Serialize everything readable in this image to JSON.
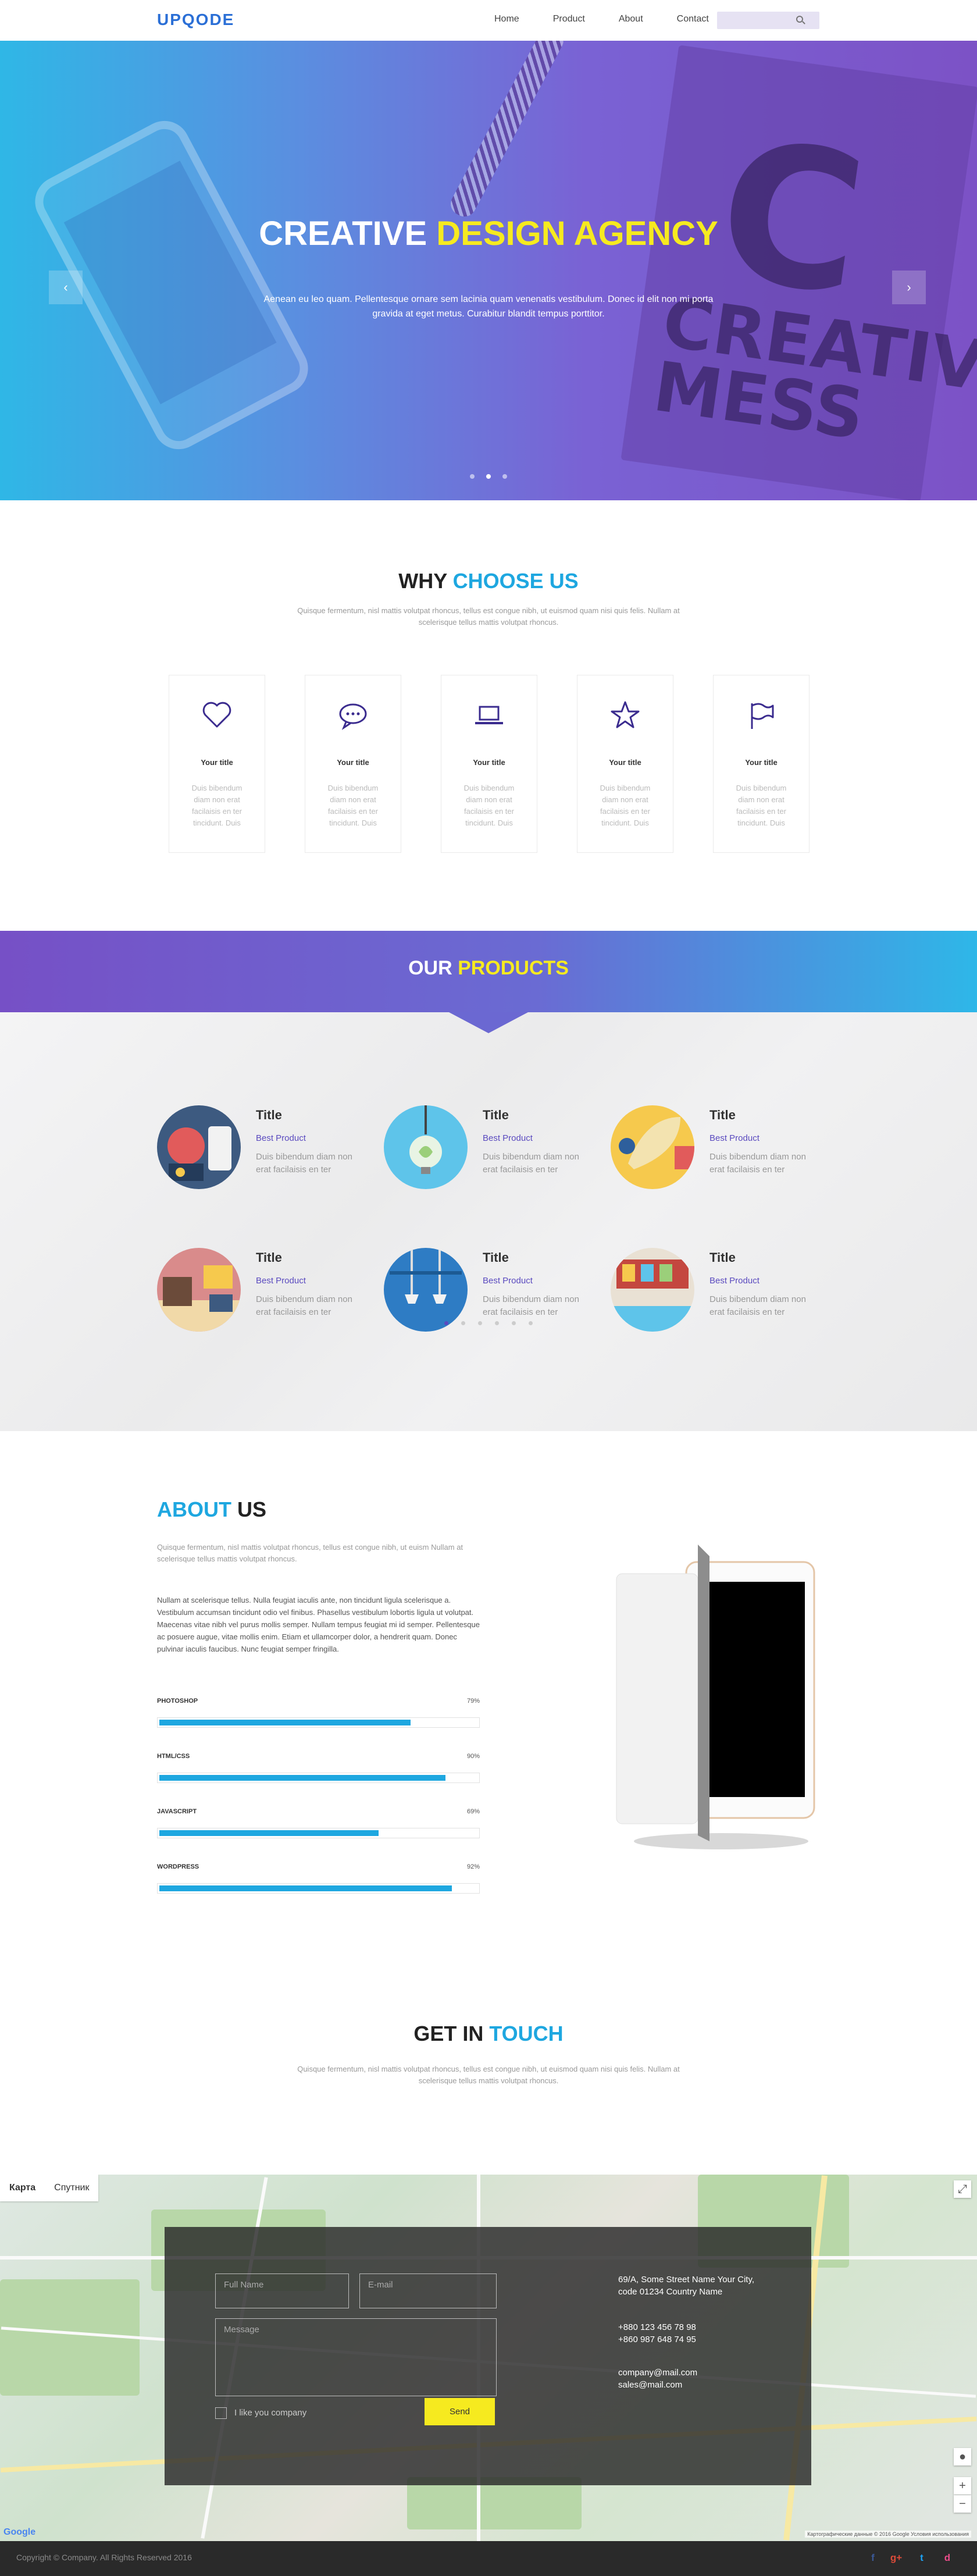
{
  "header": {
    "logo": "UPQODE",
    "nav": [
      "Home",
      "Product",
      "About",
      "Contact"
    ]
  },
  "hero": {
    "title_part1": "CREATIVE",
    "title_part2": "DESIGN AGENCY",
    "text": "Aenean eu leo quam. Pellentesque ornare sem lacinia quam venenatis vestibulum. Donec id elit non mi porta gravida at eget metus. Curabitur blandit tempus porttitor.",
    "bg_letter": "C",
    "bg_words": [
      "CREATIVE",
      "MESS"
    ],
    "prev_arrow": "‹",
    "next_arrow": "›"
  },
  "why": {
    "title_part1": "WHY",
    "title_part2": "CHOOSE US",
    "subtitle": "Quisque fermentum, nisl mattis volutpat rhoncus, tellus est congue nibh, ut euismod quam nisi quis felis. Nullam at scelerisque tellus mattis volutpat rhoncus.",
    "cards": [
      {
        "icon": "heart-icon",
        "title": "Your title",
        "text": "Duis bibendum diam non erat facilaisis en ter tincidunt. Duis"
      },
      {
        "icon": "chat-icon",
        "title": "Your title",
        "text": "Duis bibendum diam non erat facilaisis en ter tincidunt. Duis"
      },
      {
        "icon": "laptop-icon",
        "title": "Your title",
        "text": "Duis bibendum diam non erat facilaisis en ter tincidunt. Duis"
      },
      {
        "icon": "star-icon",
        "title": "Your title",
        "text": "Duis bibendum diam non erat facilaisis en ter tincidunt. Duis"
      },
      {
        "icon": "flag-icon",
        "title": "Your title",
        "text": "Duis bibendum diam non erat facilaisis en ter tincidunt. Duis"
      }
    ]
  },
  "products": {
    "title_part1": "OUR",
    "title_part2": "PRODUCTS",
    "items": [
      {
        "title": "Title",
        "subtitle": "Best Product",
        "text": "Duis bibendum diam non erat facilaisis en ter"
      },
      {
        "title": "Title",
        "subtitle": "Best Product",
        "text": "Duis bibendum diam non erat facilaisis en ter"
      },
      {
        "title": "Title",
        "subtitle": "Best Product",
        "text": "Duis bibendum diam non erat facilaisis en ter"
      },
      {
        "title": "Title",
        "subtitle": "Best Product",
        "text": "Duis bibendum diam non erat facilaisis en ter"
      },
      {
        "title": "Title",
        "subtitle": "Best Product",
        "text": "Duis bibendum diam non erat facilaisis en ter"
      },
      {
        "title": "Title",
        "subtitle": "Best Product",
        "text": "Duis bibendum diam non erat facilaisis en ter"
      }
    ]
  },
  "about": {
    "title_part1": "ABOUT",
    "title_part2": "US",
    "subtitle": "Quisque fermentum, nisl mattis volutpat rhoncus, tellus est congue nibh, ut euism Nullam at scelerisque tellus mattis volutpat rhoncus.",
    "body": "Nullam at scelerisque tellus. Nulla feugiat iaculis ante, non tincidunt ligula scelerisque a. Vestibulum accumsan tincidunt odio vel finibus. Phasellus vestibulum lobortis ligula ut volutpat. Maecenas vitae nibh vel purus mollis semper. Nullam tempus feugiat mi id semper. Pellentesque ac posuere augue, vitae mollis enim. Etiam et ullamcorper dolor, a hendrerit quam. Donec pulvinar iaculis faucibus. Nunc feugiat semper fringilla.",
    "skills": [
      {
        "name": "PHOTOSHOP",
        "percent": "79%",
        "value": 79
      },
      {
        "name": "HTML/CSS",
        "percent": "90%",
        "value": 90
      },
      {
        "name": "JAVASCRIPT",
        "percent": "69%",
        "value": 69
      },
      {
        "name": "WORDPRESS",
        "percent": "92%",
        "value": 92
      }
    ]
  },
  "contact": {
    "title_part1": "GET IN",
    "title_part2": "TOUCH",
    "subtitle": "Quisque fermentum, nisl mattis volutpat rhoncus, tellus est congue nibh, ut euismod quam nisi quis felis. Nullam at scelerisque tellus mattis volutpat rhoncus.",
    "form": {
      "name_placeholder": "Full Name",
      "email_placeholder": "E-mail",
      "message_placeholder": "Message",
      "checkbox_label": "I like you company",
      "send_label": "Send"
    },
    "address_line1": "69/A, Some Street Name Your City,",
    "address_line2": "code 01234 Country Name",
    "phone1": "+880 123 456 78 98",
    "phone2": "+860 987 648 74 95",
    "email1": "company@mail.com",
    "email2": "sales@mail.com"
  },
  "map": {
    "tab_map": "Карта",
    "tab_satellite": "Спутник",
    "zoom_in": "+",
    "zoom_out": "−",
    "google": "Google",
    "terms": "Картографические данные © 2016 Google  Условия использования"
  },
  "footer": {
    "copyright": "Copyright © Company. All Rights Reserved 2016",
    "social": [
      "f",
      "g+",
      "t",
      "d"
    ]
  },
  "colors": {
    "accent_blue": "#1ea7e0",
    "accent_yellow": "#f6ea1f",
    "purple": "#7650c6"
  }
}
